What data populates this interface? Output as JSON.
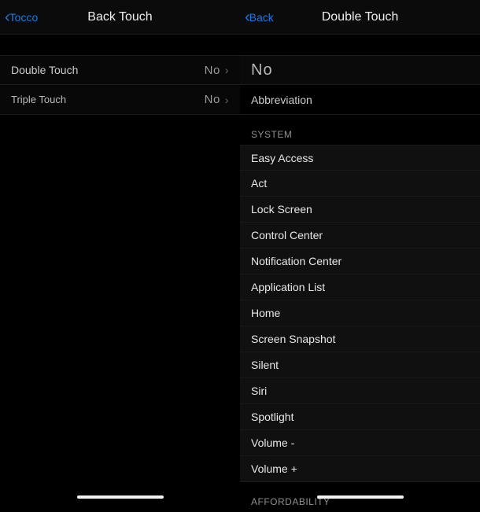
{
  "left": {
    "back_label": "Tocco",
    "title": "Back Touch",
    "rows": [
      {
        "label": "Double Touch",
        "value": "No"
      },
      {
        "label": "Triple Touch",
        "value": "No"
      }
    ]
  },
  "right": {
    "back_label": "Back",
    "title": "Double Touch",
    "current_value": "No",
    "abbrev_label": "Abbreviation",
    "section_system": "SYSTEM",
    "options": [
      "Easy Access",
      "Act",
      "Lock Screen",
      "Control Center",
      "Notification Center",
      "Application List",
      "Home",
      "Screen Snapshot",
      "Silent",
      "Siri",
      "Spotlight",
      "Volume -",
      "Volume +"
    ],
    "section_afford": "AFFORDABILITY"
  }
}
